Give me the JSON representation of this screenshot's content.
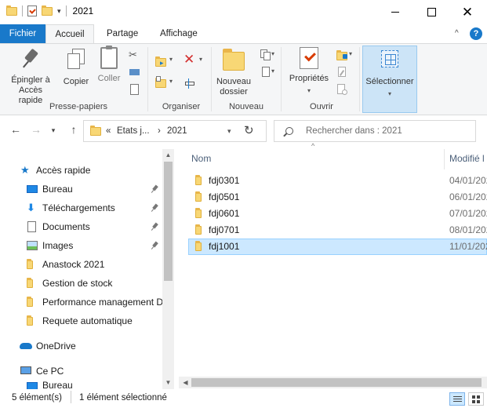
{
  "window": {
    "title": "2021",
    "minimize_icon": "minimize-icon",
    "maximize_icon": "maximize-icon",
    "close_glyph": "✕"
  },
  "ribbon_tabs": [
    {
      "label": "Fichier"
    },
    {
      "label": "Accueil"
    },
    {
      "label": "Partage"
    },
    {
      "label": "Affichage"
    }
  ],
  "ribbon": {
    "groups": {
      "clipboard": "Presse-papiers",
      "organize": "Organiser",
      "new": "Nouveau",
      "open": "Ouvrir"
    },
    "pin_label_1": "Épingler à",
    "pin_label_2": "Accès rapide",
    "copy_label": "Copier",
    "paste_label": "Coller",
    "new_folder_1": "Nouveau",
    "new_folder_2": "dossier",
    "properties_label": "Propriétés",
    "select_label": "Sélectionner"
  },
  "address": {
    "overflow": "«",
    "crumb1": "Etats j...",
    "sep": "›",
    "crumb2": "2021",
    "search_placeholder": "Rechercher dans : 2021"
  },
  "nav": {
    "quick_access": "Accès rapide",
    "items": [
      {
        "label": "Bureau",
        "pinned": true
      },
      {
        "label": "Téléchargements",
        "pinned": true
      },
      {
        "label": "Documents",
        "pinned": true
      },
      {
        "label": "Images",
        "pinned": true
      },
      {
        "label": "Anastock 2021",
        "pinned": false
      },
      {
        "label": "Gestion de stock",
        "pinned": false
      },
      {
        "label": "Performance management D",
        "pinned": false
      },
      {
        "label": "Requete automatique",
        "pinned": false
      }
    ],
    "onedrive": "OneDrive",
    "this_pc": "Ce PC",
    "pc_child": "Bureau"
  },
  "columns": {
    "name": "Nom",
    "modified": "Modifié l"
  },
  "files": [
    {
      "name": "fdj0301",
      "date": "04/01/202"
    },
    {
      "name": "fdj0501",
      "date": "06/01/202"
    },
    {
      "name": "fdj0601",
      "date": "07/01/202"
    },
    {
      "name": "fdj0701",
      "date": "08/01/202"
    },
    {
      "name": "fdj1001",
      "date": "11/01/202",
      "selected": true
    }
  ],
  "status": {
    "count": "5 élément(s)",
    "selection": "1 élément sélectionné"
  },
  "colors": {
    "accent": "#1979ca",
    "folder": "#f8d775",
    "selection": "#cce8ff"
  }
}
